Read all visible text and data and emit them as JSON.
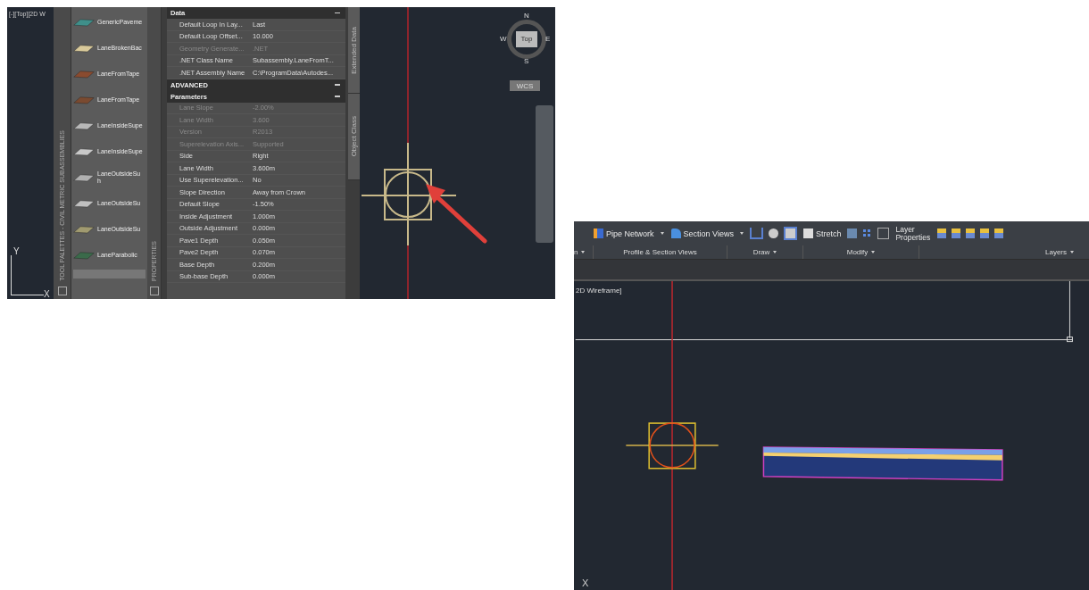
{
  "left_screenshot": {
    "viewport_label": "[-][Top][2D W",
    "tool_palette": {
      "title": "TOOL PALETTES - CIVIL METRIC SUBASSEMBLIES",
      "items": [
        {
          "label": "GenericPaveme"
        },
        {
          "label": "LaneBrokenBac"
        },
        {
          "label": "LaneFromTape"
        },
        {
          "label": "LaneFromTape"
        },
        {
          "label": "LaneInsideSupe"
        },
        {
          "label": "LaneInsideSupe"
        },
        {
          "label": "LaneOutsideSu h"
        },
        {
          "label": "LaneOutsideSu"
        },
        {
          "label": "LaneOutsideSu"
        },
        {
          "label": "LaneParabolic"
        }
      ]
    },
    "properties_tab": "PROPERTIES",
    "properties": {
      "sections": [
        {
          "title": "Data",
          "expanded": true,
          "rows": [
            {
              "name": "Default Loop In Lay...",
              "value": "Last",
              "disabled": false
            },
            {
              "name": "Default Loop Offset...",
              "value": "10.000",
              "disabled": false
            },
            {
              "name": "Geometry Generate...",
              "value": ".NET",
              "disabled": true
            },
            {
              "name": ".NET Class Name",
              "value": "Subassembly.LaneFromT...",
              "disabled": false
            },
            {
              "name": ".NET Assembly Name",
              "value": "C:\\ProgramData\\Autodes...",
              "disabled": false
            }
          ]
        },
        {
          "title": "ADVANCED",
          "expanded": true
        },
        {
          "title": "Parameters",
          "expanded": true,
          "rows": [
            {
              "name": "Lane Slope",
              "value": "-2.00%",
              "disabled": true
            },
            {
              "name": "Lane Width",
              "value": "3.600",
              "disabled": true
            },
            {
              "name": "Version",
              "value": "R2013",
              "disabled": true
            },
            {
              "name": "Superelevation Axis...",
              "value": "Supported",
              "disabled": true
            },
            {
              "name": "Side",
              "value": "Right",
              "disabled": false
            },
            {
              "name": "Lane Width",
              "value": "3.600m",
              "disabled": false
            },
            {
              "name": "Use Superelevation...",
              "value": "No",
              "disabled": false
            },
            {
              "name": "Slope Direction",
              "value": "Away from Crown",
              "disabled": false
            },
            {
              "name": "Default Slope",
              "value": "-1.50%",
              "disabled": false
            },
            {
              "name": "Inside Adjustment",
              "value": "1.000m",
              "disabled": false
            },
            {
              "name": "Outside Adjustment",
              "value": "0.000m",
              "disabled": false
            },
            {
              "name": "Pave1 Depth",
              "value": "0.050m",
              "disabled": false
            },
            {
              "name": "Pave2 Depth",
              "value": "0.070m",
              "disabled": false
            },
            {
              "name": "Base Depth",
              "value": "0.200m",
              "disabled": false
            },
            {
              "name": "Sub-base Depth",
              "value": "0.000m",
              "disabled": false
            }
          ]
        }
      ]
    },
    "side_tabs": [
      "Extended Data",
      "Object Class"
    ],
    "compass": {
      "north": "N",
      "south": "S",
      "east": "E",
      "west": "W",
      "face": "Top"
    },
    "ucs_menu": "WCS",
    "ucs": {
      "x": "X",
      "y": "Y"
    }
  },
  "right_screenshot": {
    "ribbon": {
      "pipe_network": "Pipe Network",
      "section_views": "Section Views",
      "stretch": "Stretch",
      "layer_properties": "Layer Properties",
      "panels": [
        {
          "label": "n",
          "menu": true
        },
        {
          "label": "Profile & Section Views",
          "menu": false
        },
        {
          "label": "Draw",
          "menu": true
        },
        {
          "label": "Modify",
          "menu": true
        },
        {
          "label": "Layers",
          "menu": true
        }
      ]
    },
    "viewport_label": "2D Wireframe]",
    "ucs": {
      "x": "X"
    }
  }
}
